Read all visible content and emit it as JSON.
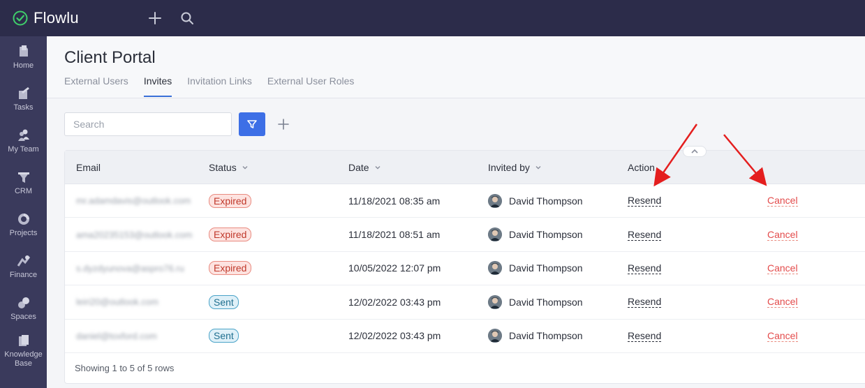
{
  "app": {
    "name": "Flowlu"
  },
  "sidebar": {
    "items": [
      {
        "label": "Home",
        "icon": "home-icon"
      },
      {
        "label": "Tasks",
        "icon": "tasks-icon"
      },
      {
        "label": "My Team",
        "icon": "team-icon"
      },
      {
        "label": "CRM",
        "icon": "crm-icon"
      },
      {
        "label": "Projects",
        "icon": "projects-icon"
      },
      {
        "label": "Finance",
        "icon": "finance-icon"
      },
      {
        "label": "Spaces",
        "icon": "spaces-icon"
      },
      {
        "label": "Knowledge",
        "label2": "Base",
        "icon": "knowledge-base-icon"
      }
    ]
  },
  "page": {
    "title": "Client Portal"
  },
  "tabs": [
    {
      "label": "External Users"
    },
    {
      "label": "Invites",
      "active": true
    },
    {
      "label": "Invitation Links"
    },
    {
      "label": "External User Roles"
    }
  ],
  "toolbar": {
    "search_placeholder": "Search"
  },
  "table": {
    "columns": {
      "email": "Email",
      "status": "Status",
      "date": "Date",
      "invited_by": "Invited by",
      "action": "Action"
    },
    "rows": [
      {
        "email": "mr.adamdavis@outlook.com",
        "status": "Expired",
        "date": "11/18/2021 08:35 am",
        "invited_by": "David Thompson",
        "resend": "Resend",
        "cancel": "Cancel"
      },
      {
        "email": "ama20235153@outlook.com",
        "status": "Expired",
        "date": "11/18/2021 08:51 am",
        "invited_by": "David Thompson",
        "resend": "Resend",
        "cancel": "Cancel"
      },
      {
        "email": "s.dyzdyunova@aspro76.ru",
        "status": "Expired",
        "date": "10/05/2022 12:07 pm",
        "invited_by": "David Thompson",
        "resend": "Resend",
        "cancel": "Cancel"
      },
      {
        "email": "leiri20@outlook.com",
        "status": "Sent",
        "date": "12/02/2022 03:43 pm",
        "invited_by": "David Thompson",
        "resend": "Resend",
        "cancel": "Cancel"
      },
      {
        "email": "daniel@toxford.com",
        "status": "Sent",
        "date": "12/02/2022 03:43 pm",
        "invited_by": "David Thompson",
        "resend": "Resend",
        "cancel": "Cancel"
      }
    ],
    "footer": "Showing 1 to 5 of 5 rows"
  },
  "colors": {
    "topbar": "#2c2c4a",
    "sidebar": "#3a3a5c",
    "accent": "#3d6fe6",
    "logo_green": "#3fce6b",
    "expired": "#c0392b",
    "sent": "#1f6f8f",
    "cancel": "#e34b4b",
    "annotation_arrow": "#e41e1e"
  }
}
